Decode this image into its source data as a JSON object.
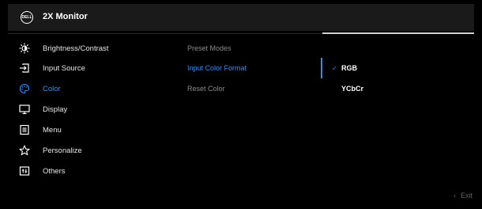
{
  "header": {
    "logo_text": "DELL",
    "title": "2X Monitor"
  },
  "menu": {
    "items": [
      {
        "label": "Brightness/Contrast",
        "icon": "brightness-icon"
      },
      {
        "label": "Input Source",
        "icon": "input-source-icon"
      },
      {
        "label": "Color",
        "icon": "color-palette-icon",
        "active": true
      },
      {
        "label": "Display",
        "icon": "display-monitor-icon"
      },
      {
        "label": "Menu",
        "icon": "menu-list-icon"
      },
      {
        "label": "Personalize",
        "icon": "star-icon"
      },
      {
        "label": "Others",
        "icon": "others-icon"
      }
    ]
  },
  "submenu": {
    "items": [
      {
        "label": "Preset Modes"
      },
      {
        "label": "Input Color Format",
        "active": true
      },
      {
        "label": "Reset Color"
      }
    ]
  },
  "options": {
    "items": [
      {
        "label": "RGB",
        "checked": true,
        "check_glyph": "✓"
      },
      {
        "label": "YCbCr",
        "checked": false,
        "check_glyph": ""
      }
    ]
  },
  "footer": {
    "exit_label": "Exit",
    "exit_glyph": "‹"
  },
  "colors": {
    "accent": "#3b8cff",
    "header_bg": "#1a1a1a",
    "muted": "#8a8a8a"
  }
}
